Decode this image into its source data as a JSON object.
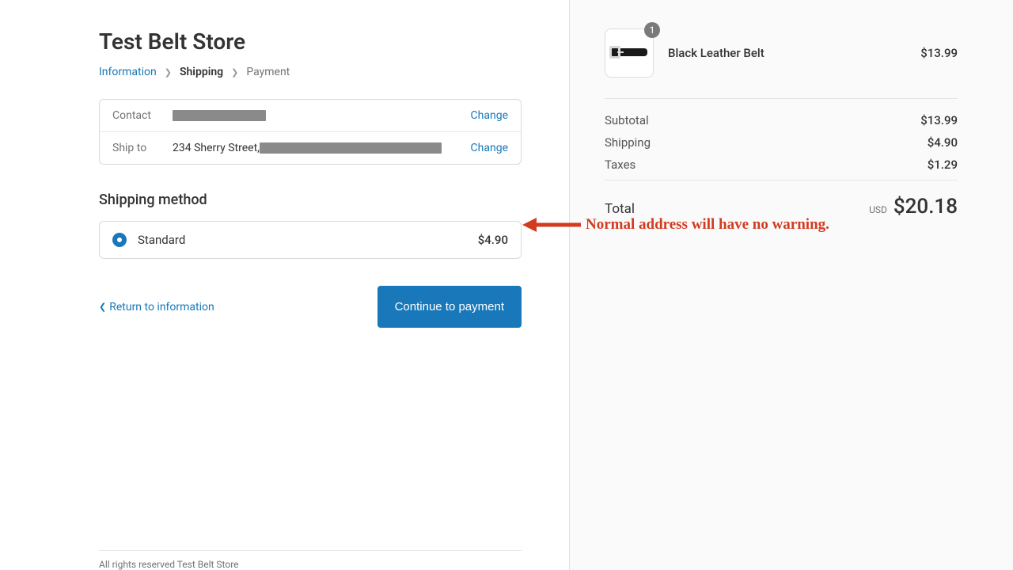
{
  "store": {
    "title": "Test Belt Store"
  },
  "breadcrumb": {
    "information": "Information",
    "shipping": "Shipping",
    "payment": "Payment"
  },
  "review": {
    "contact_label": "Contact",
    "shipto_label": "Ship to",
    "shipto_value_prefix": "234 Sherry Street,",
    "change": "Change"
  },
  "shipping": {
    "section_title": "Shipping method",
    "option_name": "Standard",
    "option_price": "$4.90"
  },
  "actions": {
    "return": "Return to information",
    "continue": "Continue to payment"
  },
  "footer": {
    "text": "All rights reserved Test Belt Store"
  },
  "cart": {
    "item_name": "Black Leather Belt",
    "item_price": "$13.99",
    "qty": "1"
  },
  "summary": {
    "subtotal_label": "Subtotal",
    "subtotal_value": "$13.99",
    "shipping_label": "Shipping",
    "shipping_value": "$4.90",
    "taxes_label": "Taxes",
    "taxes_value": "$1.29",
    "total_label": "Total",
    "total_currency": "USD",
    "total_value": "$20.18"
  },
  "annotation": {
    "text": "Normal address will have no warning."
  }
}
